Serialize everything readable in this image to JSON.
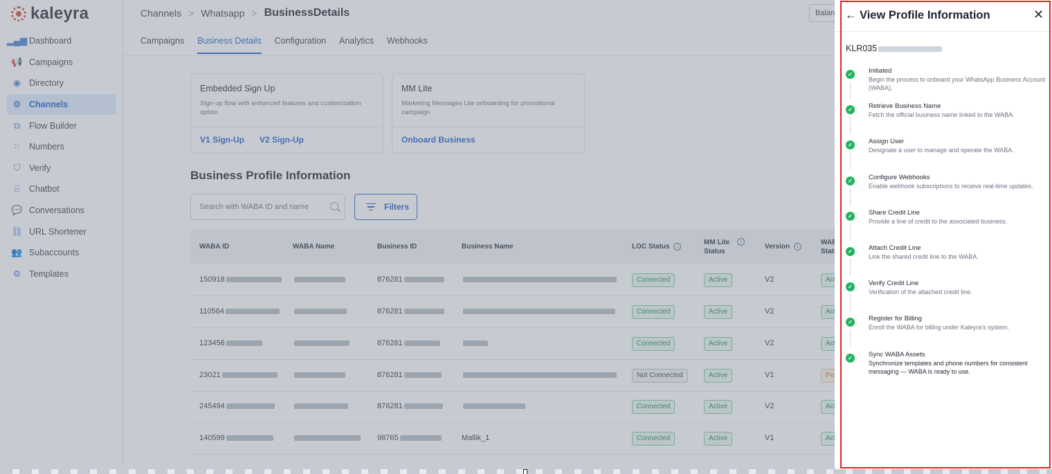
{
  "brand": {
    "name": "kaleyra"
  },
  "sidebar": {
    "items": [
      {
        "label": "Dashboard",
        "icon": "bar-chart-icon",
        "glyph": "▂▄▆",
        "active": false
      },
      {
        "label": "Campaigns",
        "icon": "megaphone-icon",
        "glyph": "📢",
        "active": false
      },
      {
        "label": "Directory",
        "icon": "contact-icon",
        "glyph": "◉",
        "active": false
      },
      {
        "label": "Channels",
        "icon": "channels-icon",
        "glyph": "⚙",
        "active": true
      },
      {
        "label": "Flow Builder",
        "icon": "flow-icon",
        "glyph": "⧉",
        "active": false
      },
      {
        "label": "Numbers",
        "icon": "dialpad-icon",
        "glyph": "⁙",
        "active": false
      },
      {
        "label": "Verify",
        "icon": "shield-icon",
        "glyph": "⛉",
        "active": false
      },
      {
        "label": "Chatbot",
        "icon": "bot-icon",
        "glyph": "⌸",
        "active": false
      },
      {
        "label": "Conversations",
        "icon": "chat-icon",
        "glyph": "💬",
        "active": false
      },
      {
        "label": "URL Shortener",
        "icon": "link-icon",
        "glyph": "⛓",
        "active": false
      },
      {
        "label": "Subaccounts",
        "icon": "users-icon",
        "glyph": "👥",
        "active": false
      },
      {
        "label": "Templates",
        "icon": "template-icon",
        "glyph": "⚙",
        "active": false
      }
    ]
  },
  "header": {
    "breadcrumb": [
      "Channels",
      "Whatsapp",
      "BusinessDetails"
    ],
    "balance_label": "Balance"
  },
  "tabs": [
    {
      "label": "Campaigns",
      "active": false
    },
    {
      "label": "Business Details",
      "active": true
    },
    {
      "label": "Configuration",
      "active": false
    },
    {
      "label": "Analytics",
      "active": false
    },
    {
      "label": "Webhooks",
      "active": false
    }
  ],
  "cards": [
    {
      "title": "Embedded Sign Up",
      "description": "Sign-up flow with enhanced features and customization option",
      "links": [
        "V1 Sign-Up",
        "V2 Sign-Up"
      ]
    },
    {
      "title": "MM Lite",
      "description": "Marketing Messages Lite onboarding for promotional campaign",
      "links": [
        "Onboard Business"
      ]
    }
  ],
  "profile_section": {
    "title": "Business Profile Information",
    "search_placeholder": "Search with WABA ID and name",
    "filters_label": "Filters"
  },
  "table": {
    "columns": [
      "WABA ID",
      "WABA Name",
      "Business ID",
      "Business Name",
      "LOC Status",
      "MM Lite Status",
      "Version",
      "WABA Status"
    ],
    "rows": [
      {
        "waba_id": "150918",
        "business_id": "876281",
        "business_name": "",
        "loc": "Connected",
        "mm": "Active",
        "version": "V2",
        "waba_status": "Active"
      },
      {
        "waba_id": "110564",
        "business_id": "876281",
        "business_name": "",
        "loc": "Connected",
        "mm": "Active",
        "version": "V2",
        "waba_status": "Active"
      },
      {
        "waba_id": "123456",
        "business_id": "876281",
        "business_name": "",
        "loc": "Connected",
        "mm": "Active",
        "version": "V2",
        "waba_status": "Active"
      },
      {
        "waba_id": "23021",
        "business_id": "876281",
        "business_name": "",
        "loc": "Not Connected",
        "mm": "Active",
        "version": "V1",
        "waba_status": "Pending"
      },
      {
        "waba_id": "245494",
        "business_id": "876281",
        "business_name": "",
        "loc": "Connected",
        "mm": "Active",
        "version": "V2",
        "waba_status": "Active"
      },
      {
        "waba_id": "140599",
        "business_id": "98765",
        "business_name": "Mallik_1",
        "loc": "Connected",
        "mm": "Active",
        "version": "V1",
        "waba_status": "Active"
      }
    ]
  },
  "drawer": {
    "title": "View Profile Information",
    "back_icon": "←",
    "close_icon": "✕",
    "record_id": "KLR035",
    "steps": [
      {
        "title": "Initiated",
        "description": "Begin the process to onboard your WhatsApp Business Account (WABA)."
      },
      {
        "title": "Retrieve Business Name",
        "description": "Fetch the official business name linked to the WABA."
      },
      {
        "title": "Assign User",
        "description": "Designate a user to manage and operate the WABA."
      },
      {
        "title": "Configure Webhooks",
        "description": "Enable webhook subscriptions to receive real-time updates."
      },
      {
        "title": "Share Credit Line",
        "description": "Provide a line of credit to the associated business."
      },
      {
        "title": "Attach Credit Line",
        "description": "Link the shared credit line to the WABA."
      },
      {
        "title": "Verify Credit Line",
        "description": "Verification of the attached credit line."
      },
      {
        "title": "Register for Billing",
        "description": "Enroll the WABA for billing under Kaleyra's system."
      },
      {
        "title": "Sync WABA Assets",
        "description": "Synchronize templates and phone numbers for consistent messaging — WABA is ready to use."
      }
    ],
    "check_glyph": "✓"
  },
  "colors": {
    "accent": "#1f5fc7",
    "success": "#22b35e",
    "highlight_outline": "#e32222"
  }
}
